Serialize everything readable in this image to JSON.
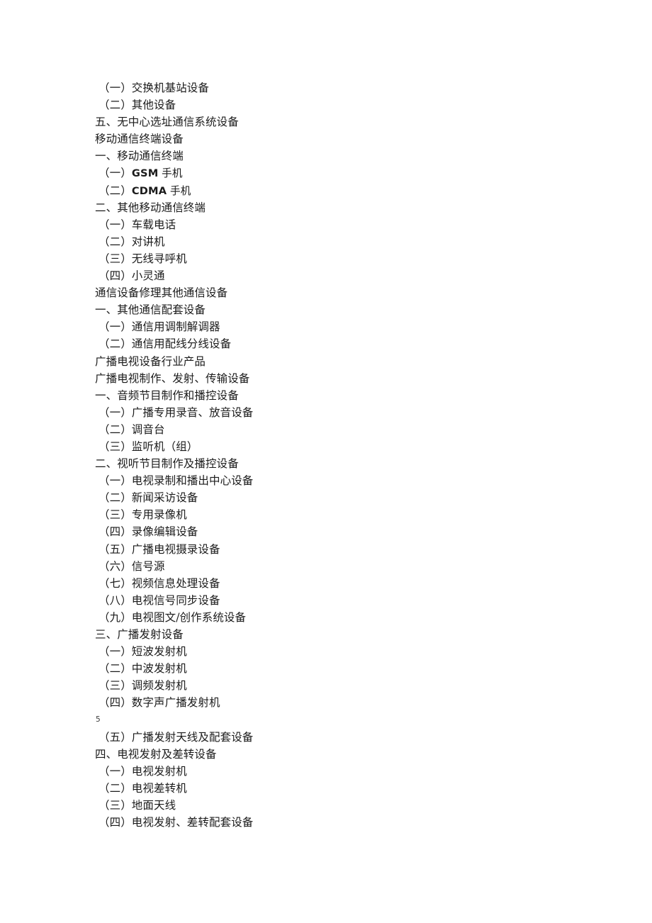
{
  "page": {
    "background_color": "#ffffff",
    "text_color": "#1b1b1b",
    "folio": "5"
  },
  "document": {
    "lines": [
      {
        "id": "l1",
        "text": "（一）交换机基站设备",
        "level": "sub"
      },
      {
        "id": "l2",
        "text": "（二）其他设备",
        "level": "sub"
      },
      {
        "id": "l3",
        "text": "五、无中心选址通信系统设备",
        "level": "top"
      },
      {
        "id": "l4",
        "text": "移动通信终端设备",
        "level": "top"
      },
      {
        "id": "l5",
        "text": "一、移动通信终端",
        "level": "top"
      },
      {
        "id": "l6",
        "text": "（一）GSM 手机",
        "level": "sub",
        "style": "sans-mix",
        "paren": "（一）",
        "latin": "GSM",
        "cjk": " 手机"
      },
      {
        "id": "l7",
        "text": "（二）CDMA 手机",
        "level": "sub",
        "style": "sans-mix",
        "paren": "（二）",
        "latin": "CDMA",
        "cjk": " 手机"
      },
      {
        "id": "l8",
        "text": "二、其他移动通信终端",
        "level": "top"
      },
      {
        "id": "l9",
        "text": "（一）车载电话",
        "level": "sub"
      },
      {
        "id": "l10",
        "text": "（二）对讲机",
        "level": "sub"
      },
      {
        "id": "l11",
        "text": "（三）无线寻呼机",
        "level": "sub"
      },
      {
        "id": "l12",
        "text": "（四）小灵通",
        "level": "sub"
      },
      {
        "id": "l13",
        "text": "通信设备修理其他通信设备",
        "level": "top"
      },
      {
        "id": "l14",
        "text": "一、其他通信配套设备",
        "level": "top"
      },
      {
        "id": "l15",
        "text": "（一）通信用调制解调器",
        "level": "sub"
      },
      {
        "id": "l16",
        "text": "（二）通信用配线分线设备",
        "level": "sub"
      },
      {
        "id": "l17",
        "text": "广播电视设备行业产品",
        "level": "top"
      },
      {
        "id": "l18",
        "text": "广播电视制作、发射、传输设备",
        "level": "top"
      },
      {
        "id": "l19",
        "text": "一、音频节目制作和播控设备",
        "level": "top"
      },
      {
        "id": "l20",
        "text": "（一）广播专用录音、放音设备",
        "level": "sub"
      },
      {
        "id": "l21",
        "text": "（二）调音台",
        "level": "sub"
      },
      {
        "id": "l22",
        "text": "（三）监听机（组）",
        "level": "sub"
      },
      {
        "id": "l23",
        "text": "二、视听节目制作及播控设备",
        "level": "top"
      },
      {
        "id": "l24",
        "text": "（一）电视录制和播出中心设备",
        "level": "sub"
      },
      {
        "id": "l25",
        "text": "（二）新闻采访设备",
        "level": "sub"
      },
      {
        "id": "l26",
        "text": "（三）专用录像机",
        "level": "sub"
      },
      {
        "id": "l27",
        "text": "（四）录像编辑设备",
        "level": "sub"
      },
      {
        "id": "l28",
        "text": "（五）广播电视摄录设备",
        "level": "sub"
      },
      {
        "id": "l29",
        "text": "（六）信号源",
        "level": "sub"
      },
      {
        "id": "l30",
        "text": "（七）视频信息处理设备",
        "level": "sub"
      },
      {
        "id": "l31",
        "text": "（八）电视信号同步设备",
        "level": "sub"
      },
      {
        "id": "l32",
        "text": "（九）电视图文/创作系统设备",
        "level": "sub"
      },
      {
        "id": "l33",
        "text": "三、广播发射设备",
        "level": "top"
      },
      {
        "id": "l34",
        "text": "（一）短波发射机",
        "level": "sub"
      },
      {
        "id": "l35",
        "text": "（二）中波发射机",
        "level": "sub"
      },
      {
        "id": "l36",
        "text": "（三）调频发射机",
        "level": "sub"
      },
      {
        "id": "l37",
        "text": "（四）数字声广播发射机",
        "level": "sub"
      },
      {
        "id": "l38",
        "text": "5",
        "level": "folio",
        "style": "folio"
      },
      {
        "id": "l39",
        "text": "（五）广播发射天线及配套设备",
        "level": "sub"
      },
      {
        "id": "l40",
        "text": "四、电视发射及差转设备",
        "level": "top"
      },
      {
        "id": "l41",
        "text": "（一）电视发射机",
        "level": "sub"
      },
      {
        "id": "l42",
        "text": "（二）电视差转机",
        "level": "sub"
      },
      {
        "id": "l43",
        "text": "（三）地面天线",
        "level": "sub"
      },
      {
        "id": "l44",
        "text": "（四）电视发射、差转配套设备",
        "level": "sub"
      }
    ]
  }
}
